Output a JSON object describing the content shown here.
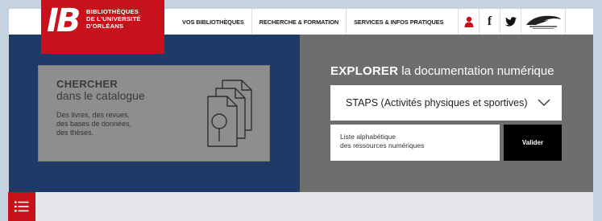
{
  "logo": {
    "mark": "IB",
    "lines": [
      "BIBLIOTHÈQUES",
      "DE L'UNIVERSITÉ",
      "D'ORLÉANS"
    ]
  },
  "nav": {
    "items": [
      "VOS BIBLIOTHÈQUES",
      "RECHERCHE & FORMATION",
      "SERVICES & INFOS PRATIQUES"
    ],
    "icons": [
      "user-icon",
      "facebook-icon",
      "twitter-icon",
      "university-logo-icon"
    ]
  },
  "search_card": {
    "title": "CHERCHER",
    "subtitle": "dans le catalogue",
    "description": [
      "Des livres, des revues,",
      "des bases de données,",
      "des thèses."
    ],
    "icon": "documents-search-icon"
  },
  "explore": {
    "title_bold": "EXPLORER",
    "title_rest": " la documentation numérique",
    "selected_option": "STAPS (Activités physiques et sportives)",
    "list_link": [
      "Liste alphabétique",
      "des ressources numériques"
    ],
    "submit_label": "Valider"
  },
  "colors": {
    "brand_red": "#c8111b",
    "navy": "#1e3a67",
    "panel_grey": "#6e6e6e",
    "card_grey": "#8e8e8e"
  },
  "menu": {
    "icon": "list-menu-icon"
  }
}
